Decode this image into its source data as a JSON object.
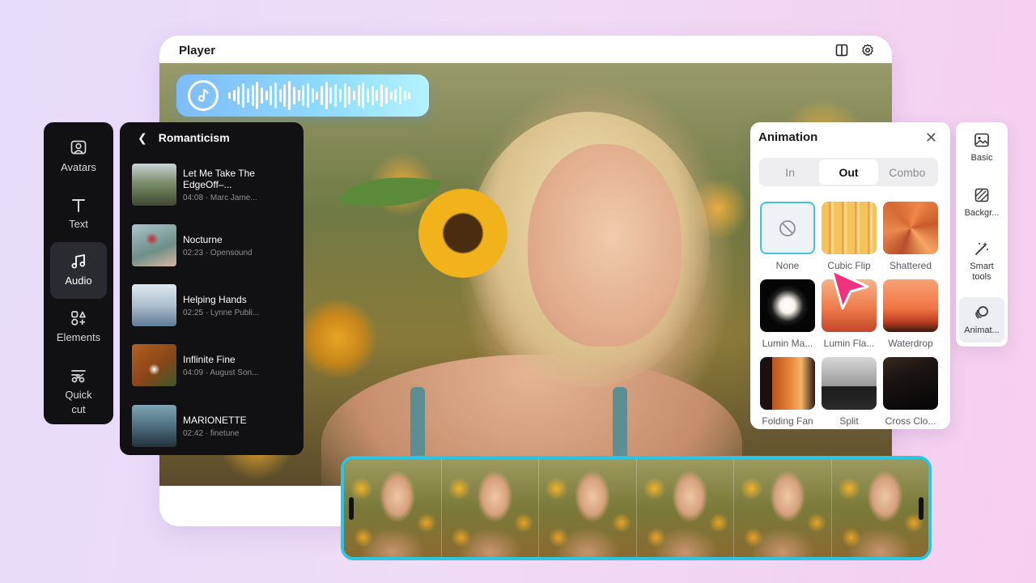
{
  "player": {
    "title": "Player"
  },
  "tools": [
    {
      "label": "Avatars",
      "icon": "avatar-icon"
    },
    {
      "label": "Text",
      "icon": "text-icon"
    },
    {
      "label": "Audio",
      "icon": "music-note-icon"
    },
    {
      "label": "Elements",
      "icon": "elements-icon"
    },
    {
      "label": "Quick cut",
      "icon": "quick-cut-icon"
    }
  ],
  "music": {
    "title": "Romanticism",
    "tracks": [
      {
        "name": "Let Me Take The EdgeOff–...",
        "meta": "04:08 · Marc Jame..."
      },
      {
        "name": "Nocturne",
        "meta": "02:23 · Opensound"
      },
      {
        "name": "Helping Hands",
        "meta": "02:25 · Lynne Publi..."
      },
      {
        "name": "Inflinite Fine",
        "meta": "04:09 · August Son..."
      },
      {
        "name": "MARIONETTE",
        "meta": "02:42 · finetune"
      }
    ]
  },
  "animation": {
    "title": "Animation",
    "tabs": [
      "In",
      "Out",
      "Combo"
    ],
    "active_tab": "Out",
    "effects": [
      "None",
      "Cubic Flip",
      "Shattered",
      "Lumin Ma...",
      "Lumin Fla...",
      "Waterdrop",
      "Folding Fan",
      "Split",
      "Cross Clo..."
    ],
    "selected_effect": "None"
  },
  "props": [
    {
      "label": "Basic",
      "icon": "image-icon"
    },
    {
      "label": "Backgr...",
      "icon": "background-icon"
    },
    {
      "label": "Smart tools",
      "icon": "magic-wand-icon"
    },
    {
      "label": "Animat...",
      "icon": "animation-icon"
    }
  ],
  "colors": {
    "accent": "#2cc6e4",
    "cursor": "#f0327e",
    "panel_dark": "#111114"
  }
}
